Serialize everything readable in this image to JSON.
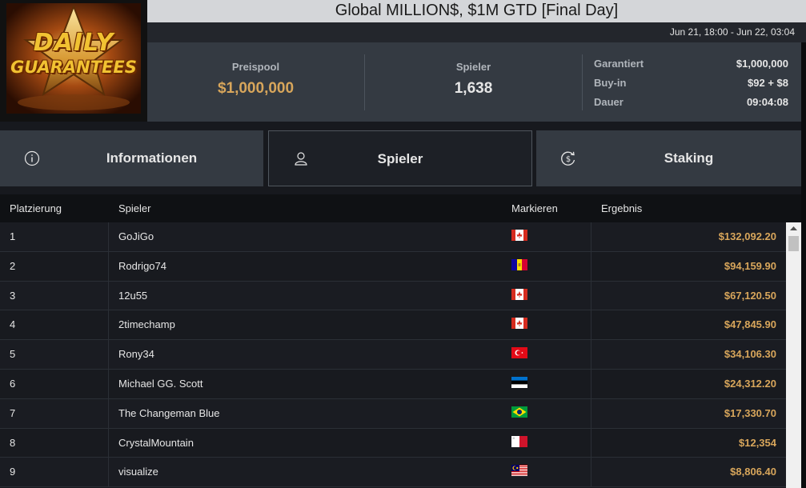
{
  "logo": {
    "line1": "DAILY",
    "line2": "GUARANTEES"
  },
  "title": "Global MILLION$, $1M GTD [Final Day]",
  "date_range": "Jun 21, 18:00 - Jun 22, 03:04",
  "stats": {
    "prize_pool_label": "Preispool",
    "prize_pool_value": "$1,000,000",
    "players_label": "Spieler",
    "players_value": "1,638"
  },
  "details": {
    "guaranteed_label": "Garantiert",
    "guaranteed_value": "$1,000,000",
    "buyin_label": "Buy-in",
    "buyin_value": "$92 + $8",
    "duration_label": "Dauer",
    "duration_value": "09:04:08"
  },
  "tabs": [
    {
      "label": "Informationen",
      "icon": "info-icon"
    },
    {
      "label": "Spieler",
      "icon": "user-icon"
    },
    {
      "label": "Staking",
      "icon": "dollar-refresh-icon"
    }
  ],
  "table": {
    "headers": {
      "rank": "Platzierung",
      "player": "Spieler",
      "flag": "Markieren",
      "result": "Ergebnis"
    },
    "rows": [
      {
        "rank": "1",
        "player": "GoJiGo",
        "country": "canada",
        "result": "$132,092.20"
      },
      {
        "rank": "2",
        "player": "Rodrigo74",
        "country": "andorra",
        "result": "$94,159.90"
      },
      {
        "rank": "3",
        "player": "12u55",
        "country": "canada",
        "result": "$67,120.50"
      },
      {
        "rank": "4",
        "player": "2timechamp",
        "country": "canada",
        "result": "$47,845.90"
      },
      {
        "rank": "5",
        "player": "Rony34",
        "country": "turkey",
        "result": "$34,106.30"
      },
      {
        "rank": "6",
        "player": "Michael GG. Scott",
        "country": "estonia",
        "result": "$24,312.20"
      },
      {
        "rank": "7",
        "player": "The Changeman Blue",
        "country": "brazil",
        "result": "$17,330.70"
      },
      {
        "rank": "8",
        "player": "CrystalMountain",
        "country": "malta",
        "result": "$12,354"
      },
      {
        "rank": "9",
        "player": "visualize",
        "country": "malaysia",
        "result": "$8,806.40"
      }
    ]
  },
  "colors": {
    "accent_gold": "#d8a65b",
    "panel": "#343a42",
    "background": "#17191e"
  }
}
